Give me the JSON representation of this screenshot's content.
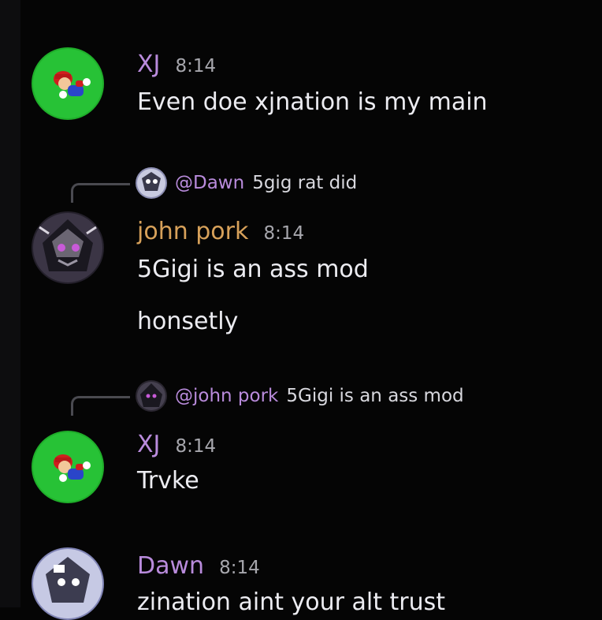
{
  "colors": {
    "background": "#050505",
    "xj_name": "#b98bdc",
    "john_name": "#d7a15a",
    "dawn_name": "#b98bdc",
    "mention": "#b98bdc",
    "timestamp": "#a7a7ad"
  },
  "messages": [
    {
      "username": "XJ",
      "time": "8:14",
      "avatar": "mario-avatar",
      "lines": [
        "Even doe xjnation is my main"
      ]
    },
    {
      "reply": {
        "mention": "@Dawn",
        "text": "5gig rat did",
        "avatar": "dawn-mini-avatar"
      },
      "username": "john pork",
      "time": "8:14",
      "avatar": "dark-character-avatar",
      "lines": [
        "5Gigi is an ass mod",
        "honsetly"
      ]
    },
    {
      "reply": {
        "mention": "@john pork",
        "text": "5Gigi is an ass mod",
        "avatar": "john-mini-avatar"
      },
      "username": "XJ",
      "time": "8:14",
      "avatar": "mario-avatar",
      "lines": [
        "Trvke"
      ]
    },
    {
      "username": "Dawn",
      "time": "8:14",
      "avatar": "dawn-avatar",
      "lines": [
        "zination aint your alt trust"
      ]
    }
  ]
}
